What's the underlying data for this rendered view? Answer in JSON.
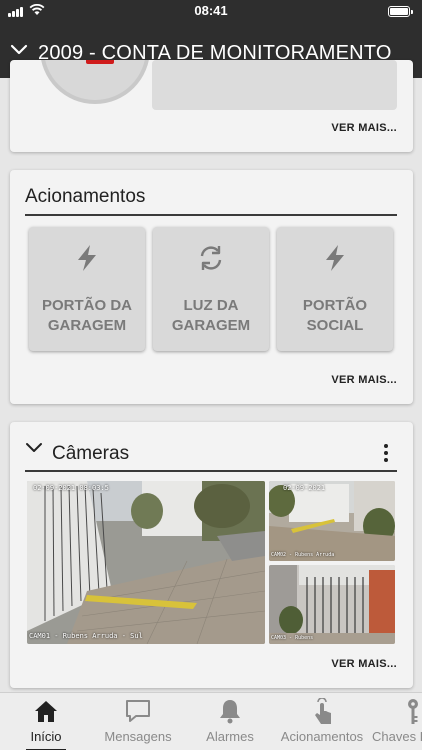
{
  "status_bar": {
    "time": "08:41"
  },
  "header": {
    "title": "2009 - CONTA DE MONITORAMENTO"
  },
  "summary_card": {
    "see_more": "VER MAIS..."
  },
  "actions_card": {
    "title": "Acionamentos",
    "buttons": [
      {
        "line1": "PORTÃO DA",
        "line2": "GARAGEM",
        "icon": "bolt-icon"
      },
      {
        "line1": "LUZ DA",
        "line2": "GARAGEM",
        "icon": "sync-icon"
      },
      {
        "line1": "PORTÃO",
        "line2": "SOCIAL",
        "icon": "bolt-icon"
      }
    ],
    "see_more": "VER MAIS..."
  },
  "cameras_card": {
    "title": "Câmeras",
    "main_camera": {
      "timestamp": "02-09-2021 08:03:5",
      "caption": "CAM01 - Rubens Arruda - Sul"
    },
    "cam2": {
      "timestamp": "02-09-2021",
      "caption": "CAM02 - Rubens Arruda"
    },
    "cam3": {
      "caption": "CAM03 - Rubens"
    },
    "see_more": "VER MAIS..."
  },
  "tab_bar": {
    "tabs": [
      {
        "label": "Início",
        "icon": "home-icon",
        "active": true
      },
      {
        "label": "Mensagens",
        "icon": "chat-icon",
        "active": false
      },
      {
        "label": "Alarmes",
        "icon": "bell-icon",
        "active": false
      },
      {
        "label": "Acionamentos",
        "icon": "tap-icon",
        "active": false
      },
      {
        "label": "Chaves D",
        "icon": "key-icon",
        "active": false
      }
    ]
  },
  "colors": {
    "header_bg": "#2e2e2e",
    "card_bg": "#f3f3f3",
    "tile_bg": "#d9d9d9",
    "tile_text": "#7a7a7a",
    "page_bg": "#e6e6e6"
  }
}
